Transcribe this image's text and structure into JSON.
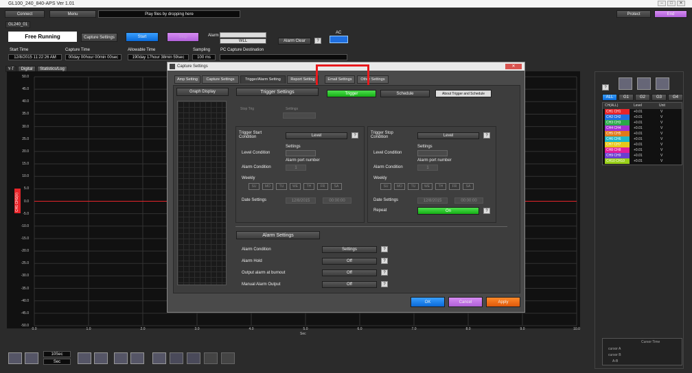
{
  "window": {
    "title": "GL100_240_840-APS Ver 1.01",
    "controls": [
      "‒",
      "□",
      "✕"
    ]
  },
  "toolbar": {
    "connect": "Connect",
    "menu": "Menu",
    "drop_hint": "Play files by dropping here",
    "protect": "Protect",
    "end": "End"
  },
  "device_tab": "GL240_01",
  "status": {
    "mode": "Free Running",
    "capture_settings": "Capture Settings",
    "start": "Start",
    "stop": "Stop",
    "alarm_label": "Alarm",
    "alarm_value": "WLL",
    "alarm_clear": "Alarm Clear",
    "alarm_clear_q": "?",
    "ac_label": "AC"
  },
  "info": {
    "start_time_label": "Start Time",
    "start_time": "12/8/2015 11:22:26 AM",
    "capture_time_label": "Capture Time",
    "capture_time": "00day 00hour 00min 00sec",
    "allowable_time_label": "Allowable Time",
    "allowable_time": "190day 17hour 38min 59sec",
    "sampling_label": "Sampling",
    "sampling": "100 ms",
    "pc_dest_label": "PC Capture Destination"
  },
  "view_tabs": [
    "Y-T",
    "Digital",
    "Statistics/Log"
  ],
  "graph": {
    "y_ticks": [
      "50.0",
      "45.0",
      "40.0",
      "35.0",
      "30.0",
      "25.0",
      "20.0",
      "15.0",
      "10.0",
      "5.0",
      "0.0",
      "-5.0",
      "-10.0",
      "-15.0",
      "-20.0",
      "-25.0",
      "-30.0",
      "-35.0",
      "-40.0",
      "-45.0",
      "-50.0"
    ],
    "x_ticks": [
      "0.0",
      "1.0",
      "2.0",
      "3.0",
      "4.0",
      "5.0",
      "6.0",
      "7.0",
      "8.0",
      "9.0",
      "10.0"
    ],
    "x_unit": "Sec",
    "channel_tag": "CH1 CH1(V)"
  },
  "dialog": {
    "title": "Capture Settings",
    "close": "✕",
    "tabs": [
      "Amp Setting",
      "Capture Settings",
      "Trigger/Alarm Setting",
      "Report Setting",
      "Email Settings",
      "Other Settings"
    ],
    "selected_tab": "Trigger/Alarm Setting",
    "graph_display": "Graph Display",
    "trigger_settings": "Trigger Settings",
    "trigger_btn": "Trigger",
    "schedule_btn": "Schedule",
    "about_btn": "About Trigger and Schedule",
    "faded": {
      "a": "Stop Trig",
      "b": "Settings"
    },
    "start": {
      "cond_label": "Trigger Start Condition",
      "cond_value": "Level",
      "settings": "Settings",
      "level_label": "Level Condition",
      "alarm_port_label": "Alarm port number",
      "alarm_port": "1",
      "alarm_label": "Alarm Condition",
      "weekly": "Weekly",
      "days": [
        "SU",
        "MO",
        "TU",
        "WE",
        "TH",
        "FR",
        "SA"
      ],
      "date_label": "Date Settings",
      "date": "12/8/2015",
      "time": "00:00:00"
    },
    "stop": {
      "cond_label": "Trigger Stop Condition",
      "cond_value": "Level",
      "settings": "Settings",
      "level_label": "Level Condition",
      "alarm_port_label": "Alarm port number",
      "alarm_port": "1",
      "alarm_label": "Alarm Condition",
      "weekly": "Weekly",
      "days": [
        "SU",
        "MO",
        "TU",
        "WE",
        "TH",
        "FR",
        "SA"
      ],
      "date_label": "Date Settings",
      "date": "12/8/2015",
      "time": "00:00:00",
      "repeat_label": "Repeat",
      "repeat_value": "On"
    },
    "alarm": {
      "header": "Alarm Settings",
      "rows": [
        {
          "label": "Alarm Condition",
          "value": "Settings"
        },
        {
          "label": "Alarm Hold",
          "value": "Off"
        },
        {
          "label": "Output alarm at burnout",
          "value": "Off"
        },
        {
          "label": "Manual Alarm Output",
          "value": "Off"
        }
      ]
    },
    "ok": "OK",
    "cancel": "Cancel",
    "apply": "Apply"
  },
  "right": {
    "group_tabs": [
      "ALL",
      "G1",
      "G2",
      "G3",
      "G4"
    ],
    "headers": [
      "CH(ALL)",
      "Level",
      "Unit"
    ],
    "channels": [
      {
        "name": "CH1  CH1",
        "level": "+0.01",
        "unit": "V",
        "color": "#e8252a"
      },
      {
        "name": "CH2  CH2",
        "level": "+0.01",
        "unit": "V",
        "color": "#1f6fe0"
      },
      {
        "name": "CH3  CH3",
        "level": "+0.01",
        "unit": "V",
        "color": "#2aa84a"
      },
      {
        "name": "CH4  CH4",
        "level": "+0.01",
        "unit": "V",
        "color": "#a52fd0"
      },
      {
        "name": "CH5  CH5",
        "level": "+0.01",
        "unit": "V",
        "color": "#e07a1a"
      },
      {
        "name": "CH6  CH6",
        "level": "+0.01",
        "unit": "V",
        "color": "#1fb8c8"
      },
      {
        "name": "CH7  CH7",
        "level": "+0.01",
        "unit": "V",
        "color": "#e8c81a"
      },
      {
        "name": "CH8  CH8",
        "level": "+0.01",
        "unit": "V",
        "color": "#e0209a"
      },
      {
        "name": "CH9  CH9",
        "level": "+0.01",
        "unit": "V",
        "color": "#6a3fd0"
      },
      {
        "name": "CH10 CH10",
        "level": "+0.01",
        "unit": "V",
        "color": "#9ad01a"
      }
    ],
    "cursor_header": "Cursor Time",
    "cursor_rows": [
      "cursor A",
      "cursor B",
      "A-B"
    ]
  },
  "bottom": {
    "time_div": "10Sec",
    "unit": "Sec"
  }
}
